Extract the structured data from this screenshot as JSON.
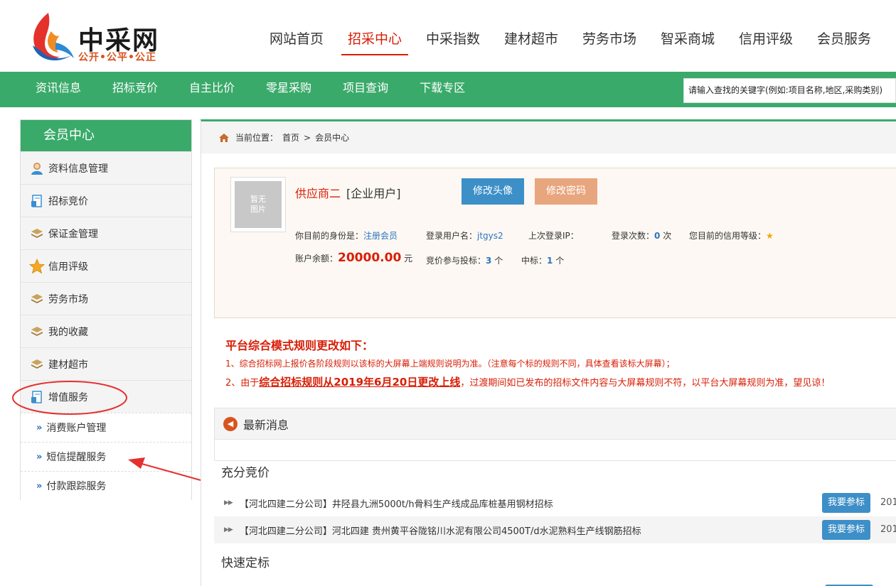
{
  "header": {
    "logo_text": "中采网",
    "logo_slogan": "公开•公平•公正",
    "nav": [
      {
        "label": "网站首页",
        "active": false
      },
      {
        "label": "招采中心",
        "active": true
      },
      {
        "label": "中采指数",
        "active": false
      },
      {
        "label": "建材超市",
        "active": false
      },
      {
        "label": "劳务市场",
        "active": false
      },
      {
        "label": "智采商城",
        "active": false
      },
      {
        "label": "信用评级",
        "active": false
      },
      {
        "label": "会员服务",
        "active": false
      }
    ]
  },
  "subnav": {
    "items": [
      "资讯信息",
      "招标竞价",
      "自主比价",
      "零星采购",
      "项目查询",
      "下载专区"
    ],
    "search_placeholder": "请输入查找的关键字(例如:项目名称,地区,采购类别)"
  },
  "sidebar": {
    "title": "会员中心",
    "items": [
      {
        "label": "资料信息管理",
        "icon": "user-icon"
      },
      {
        "label": "招标竞价",
        "icon": "document-icon"
      },
      {
        "label": "保证金管理",
        "icon": "stack-icon"
      },
      {
        "label": "信用评级",
        "icon": "star-icon"
      },
      {
        "label": "劳务市场",
        "icon": "stack-icon"
      },
      {
        "label": "我的收藏",
        "icon": "stack-icon"
      },
      {
        "label": "建材超市",
        "icon": "stack-icon"
      },
      {
        "label": "增值服务",
        "icon": "document-icon"
      }
    ],
    "sub_items": [
      "消费账户管理",
      "短信提醒服务",
      "付款跟踪服务"
    ]
  },
  "breadcrumb": {
    "prefix": "当前位置：",
    "home": "首页",
    "sep": ">",
    "current": "会员中心"
  },
  "profile": {
    "avatar_text_1": "暂无",
    "avatar_text_2": "图片",
    "name": "供应商二",
    "type": "[企业用户]",
    "btn_avatar": "修改头像",
    "btn_password": "修改密码",
    "identity_label": "你目前的身份是：",
    "identity_value": "注册会员",
    "username_label": "登录用户名：",
    "username_value": "jtgys2",
    "last_ip_label": "上次登录IP：",
    "login_count_label": "登录次数：",
    "login_count_value": "0",
    "login_count_unit": "次",
    "credit_label": "您目前的信用等级：",
    "credit_star": "★",
    "balance_label": "账户余额：",
    "balance_value": "20000.00",
    "balance_unit": "元",
    "bids_label": "竞价参与投标：",
    "bids_value": "3",
    "bids_unit": "个",
    "won_label": "中标：",
    "won_value": "1",
    "won_unit": "个"
  },
  "notice": {
    "title": "平台综合模式规则更改如下：",
    "line1": "1、综合招标网上报价各阶段规则以该标的大屏幕上端规则说明为准。（注意每个标的规则不同，具体查看该标大屏幕）；",
    "line2_pre": "2、由于",
    "line2_em": "综合招标规则从2019年6月20日更改上线",
    "line2_post": "，过渡期间如已发布的招标文件内容与大屏幕规则不符，以平台大屏幕规则为准，望见谅！"
  },
  "news": {
    "title": "最新消息",
    "section1": "充分竞价",
    "section2": "快速定标",
    "rows": [
      {
        "text": "【河北四建二分公司】井陉县九洲5000t/h骨料生产线成品库桩基用钢材招标",
        "button": "我要参标",
        "date": "201"
      },
      {
        "text": "【河北四建二分公司】河北四建 贵州黄平谷陇铭川水泥有限公司4500T/d水泥熟料生产线钢筋招标",
        "button": "我要参标",
        "date": "201"
      }
    ]
  },
  "colors": {
    "green": "#3aaa6a",
    "red": "#d81e06",
    "blue_button": "#3d8fc7",
    "orange_button": "#e8a67e"
  }
}
